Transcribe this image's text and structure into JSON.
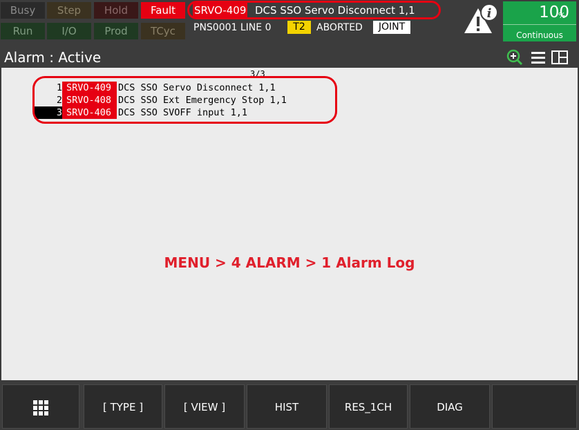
{
  "indicators": [
    {
      "label": "Busy"
    },
    {
      "label": "Step"
    },
    {
      "label": "Hold"
    },
    {
      "label": "Fault"
    },
    {
      "label": "Run"
    },
    {
      "label": "I/O"
    },
    {
      "label": "Prod"
    },
    {
      "label": "TCyc"
    }
  ],
  "status": {
    "alarm_code": "SRVO-409",
    "alarm_text": "DCS SSO Servo Disconnect 1,1",
    "program_line": "PNS0001 LINE 0",
    "teach_mode": "T2",
    "exec_state": "ABORTED",
    "coord": "JOINT",
    "info_icon": "warning-info-icon"
  },
  "override": {
    "value": "100",
    "unit": "%",
    "mode": "Continuous"
  },
  "title": "Alarm : Active",
  "page_count": "3/3",
  "alarms": [
    {
      "num": "1",
      "code": "SRVO-409",
      "message": "DCS SSO Servo Disconnect 1,1"
    },
    {
      "num": "2",
      "code": "SRVO-408",
      "message": "DCS SSO Ext Emergency Stop 1,1"
    },
    {
      "num": "3",
      "code": "SRVO-406",
      "message": "DCS SSO SVOFF input 1,1"
    }
  ],
  "menu_hint": "MENU > 4 ALARM > 1 Alarm Log",
  "fkeys": [
    {
      "label": "",
      "icon": "grid-menu-icon"
    },
    {
      "label": "[ TYPE ]"
    },
    {
      "label": "[ VIEW ]"
    },
    {
      "label": "HIST"
    },
    {
      "label": "RES_1CH"
    },
    {
      "label": "DIAG"
    },
    {
      "label": ""
    }
  ],
  "colors": {
    "fault": "#e60012",
    "override": "#1aa34a",
    "t2": "#f3d300",
    "hint": "#e0202c"
  }
}
